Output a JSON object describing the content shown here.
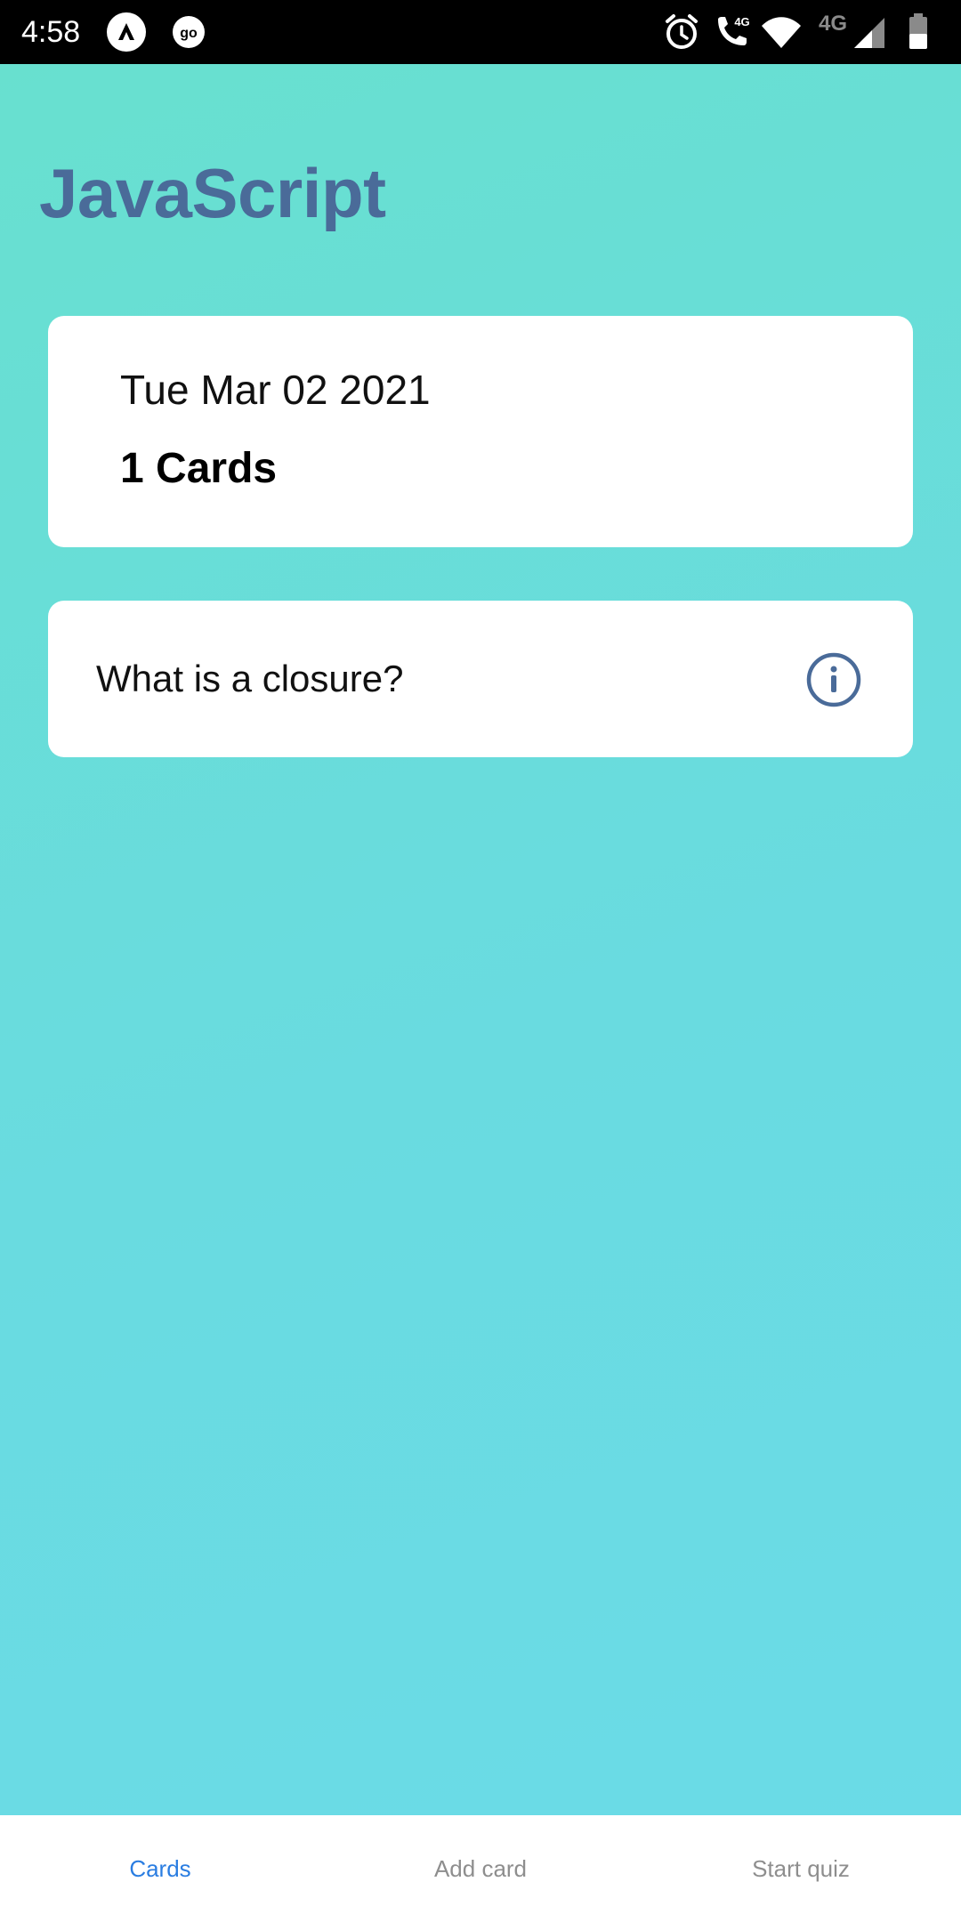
{
  "status_bar": {
    "time": "4:58",
    "icons": [
      "app-a-icon",
      "go-icon",
      "alarm-icon",
      "call-4g-icon",
      "wifi-icon",
      "signal-4g-icon",
      "battery-icon"
    ],
    "signal_label": "4G",
    "call_label": "4G"
  },
  "deck": {
    "title": "JavaScript",
    "date": "Tue Mar 02 2021",
    "count": "1 Cards"
  },
  "questions": [
    {
      "text": "What is a closure?",
      "action_icon": "info-icon"
    }
  ],
  "tabs": [
    {
      "label": "Cards",
      "active": true
    },
    {
      "label": "Add card",
      "active": false
    },
    {
      "label": "Start quiz",
      "active": false
    }
  ],
  "colors": {
    "title": "#4a6b99",
    "active_tab": "#2a7de1",
    "inactive_tab": "#8e8e8e",
    "background_start": "#68e0cf",
    "background_end": "#6adbe7"
  }
}
